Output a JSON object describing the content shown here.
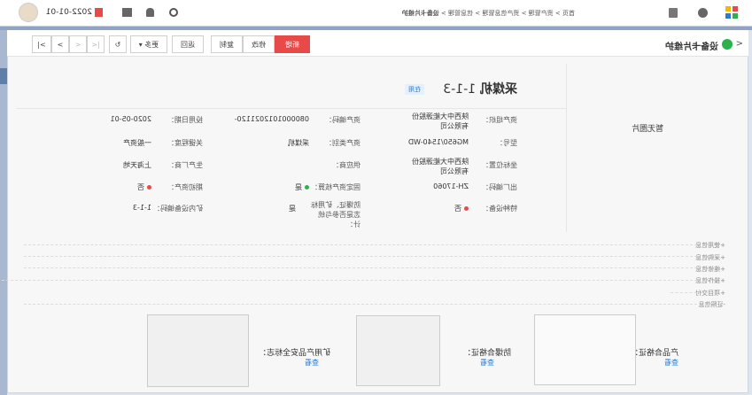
{
  "topbar": {
    "breadcrumb": [
      "首页",
      "资产管理",
      "资产信息管理",
      "信息管理",
      "设备卡片维护"
    ],
    "date": "2022-01-01"
  },
  "header": {
    "title": "设备卡片维护",
    "buttons": {
      "add": "新增",
      "edit": "修改",
      "copy": "复制",
      "back": "返回",
      "more": "更多"
    },
    "pager": [
      "|<",
      "<",
      ">",
      ">|"
    ]
  },
  "colors": {
    "primary": "#e84a4a",
    "accent": "#2a7bd8",
    "green": "#2bb24c"
  },
  "asset": {
    "placeholder": "暂无图片",
    "name": "采煤机",
    "code": "1-1-3",
    "status": "在用",
    "fields": [
      {
        "label": "资产组织：",
        "value": "陕西中大能源股份有限公司"
      },
      {
        "label": "资产编码：",
        "value": "0800001012021120-"
      },
      {
        "label": "投用日期：",
        "value": "2020-05-01"
      },
      {
        "label": "型号：",
        "value": "MG650/1540-WD"
      },
      {
        "label": "资产类别：",
        "value": "采煤机"
      },
      {
        "label": "关键程度：",
        "value": "一般资产"
      },
      {
        "label": "坐标位置：",
        "value": "陕西中大能源股份有限公司"
      },
      {
        "label": "供应商：",
        "value": ""
      },
      {
        "label": "生产厂商：",
        "value": "上海天地"
      },
      {
        "label": "出厂编码：",
        "value": "ZH-17060"
      },
      {
        "label": "固定资产核算：",
        "value": "是"
      },
      {
        "label": "期初资产：",
        "value": "否"
      },
      {
        "label": "特种设备：",
        "value": "否"
      },
      {
        "label": "防爆证、矿用标志是否参与统计：",
        "value": "是"
      },
      {
        "label": "矿内设备编码：",
        "value": "1-1-3"
      }
    ]
  },
  "sections": [
    "+使用信息",
    "+采购信息",
    "+维修信息",
    "+操作信息",
    "+项目交付",
    "-证照信息"
  ],
  "certs": [
    {
      "label": "产品合格证：",
      "link": "查看"
    },
    {
      "label": "防爆合格证：",
      "link": "查看"
    },
    {
      "label": "矿用产品安全标志：",
      "link": "查看"
    }
  ]
}
